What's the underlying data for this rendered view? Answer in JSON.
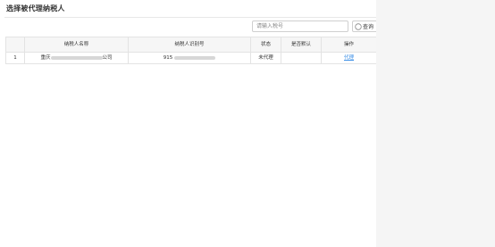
{
  "page": {
    "title": "选择被代理纳税人"
  },
  "search": {
    "placeholder": "请输入税号",
    "query_label": "查询"
  },
  "table": {
    "headers": [
      "",
      "纳税人名称",
      "纳税人识别号",
      "状态",
      "是否默认",
      "操作"
    ],
    "rows": [
      {
        "index": "1",
        "name_prefix": "重庆",
        "name_suffix": "公司",
        "taxid_prefix": "915",
        "status": "未代理",
        "is_default": "",
        "action": "代理"
      }
    ]
  },
  "colors": {
    "link": "#3a8ee6",
    "sidebar": "#f5f5f5",
    "header_bg": "#f6f6f6",
    "border": "#e3e3e3"
  }
}
